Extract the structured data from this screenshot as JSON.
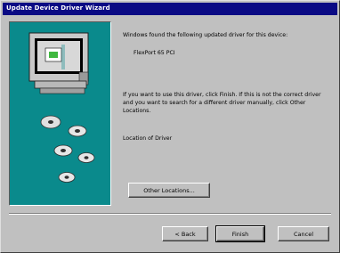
{
  "window": {
    "title": "Update Device Driver Wizard"
  },
  "content": {
    "found_text": "Windows found the following updated driver for this device:",
    "device_name": "FlexPort 65 PCI",
    "instruction_text": "If you want to use this driver, click Finish. If this is not the correct driver and you want to search for a different driver manually, click Other Locations.",
    "location_label": "Location of Driver"
  },
  "buttons": {
    "other_locations": "Other Locations...",
    "back": "< Back",
    "finish": "Finish",
    "cancel": "Cancel"
  }
}
